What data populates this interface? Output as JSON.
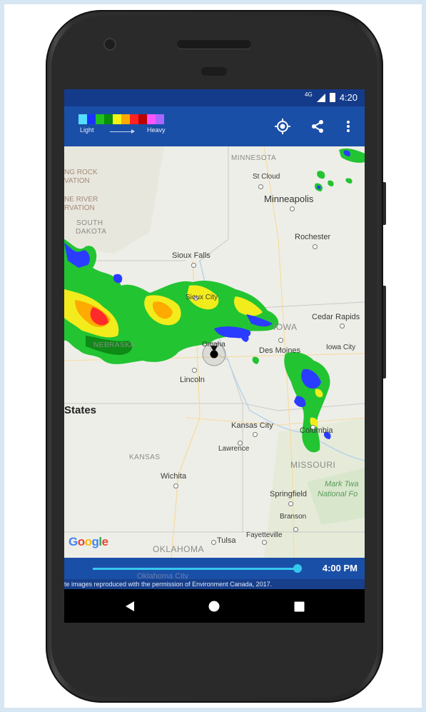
{
  "status_bar": {
    "network": "4G",
    "time": "4:20"
  },
  "app_bar": {
    "legend": {
      "light_label": "Light",
      "heavy_label": "Heavy",
      "colors": [
        "#55ddff",
        "#1a33ff",
        "#1fc21f",
        "#0a8f0a",
        "#f5f518",
        "#ffaa00",
        "#ff2222",
        "#bb0000",
        "#ff55ff",
        "#aa66ff"
      ]
    },
    "icons": [
      "my-location-icon",
      "share-icon",
      "more-vert-icon"
    ]
  },
  "map": {
    "labels": {
      "minnesota": "MINNESOTA",
      "st_cloud": "St Cloud",
      "minneapolis": "Minneapolis",
      "rochester": "Rochester",
      "sioux_falls": "Sioux Falls",
      "sioux_city": "Sioux City",
      "iowa": "IOWA",
      "cedar_rapids": "Cedar Rapids",
      "iowa_city": "Iowa City",
      "des_moines": "Des Moines",
      "omaha": "Omaha",
      "nebraska": "NEBRASKA",
      "lincoln": "Lincoln",
      "states": "States",
      "kansas_city": "Kansas City",
      "lawrence": "Lawrence",
      "columbia": "Columbia",
      "kansas": "KANSAS",
      "missouri": "MISSOURI",
      "wichita": "Wichita",
      "springfield": "Springfield",
      "mark_twain": "Mark Twa",
      "national_forest": "National Fo",
      "branson": "Branson",
      "fayetteville": "Fayetteville",
      "tulsa": "Tulsa",
      "oklahoma": "OKLAHOMA",
      "standing_rock_1": "NG ROCK",
      "standing_rock_2": "VATION",
      "cheyenne_river_1": "NE RIVER",
      "cheyenne_river_2": "RVATION",
      "south_dakota_1": "SOUTH",
      "south_dakota_2": "DAKOTA",
      "oklahoma_city": "Oklahoma City"
    },
    "google_logo": "Google"
  },
  "playback": {
    "time": "4:00 PM",
    "progress": 0.97
  },
  "credit": "te images reproduced with the permission of Environment Canada, 2017."
}
